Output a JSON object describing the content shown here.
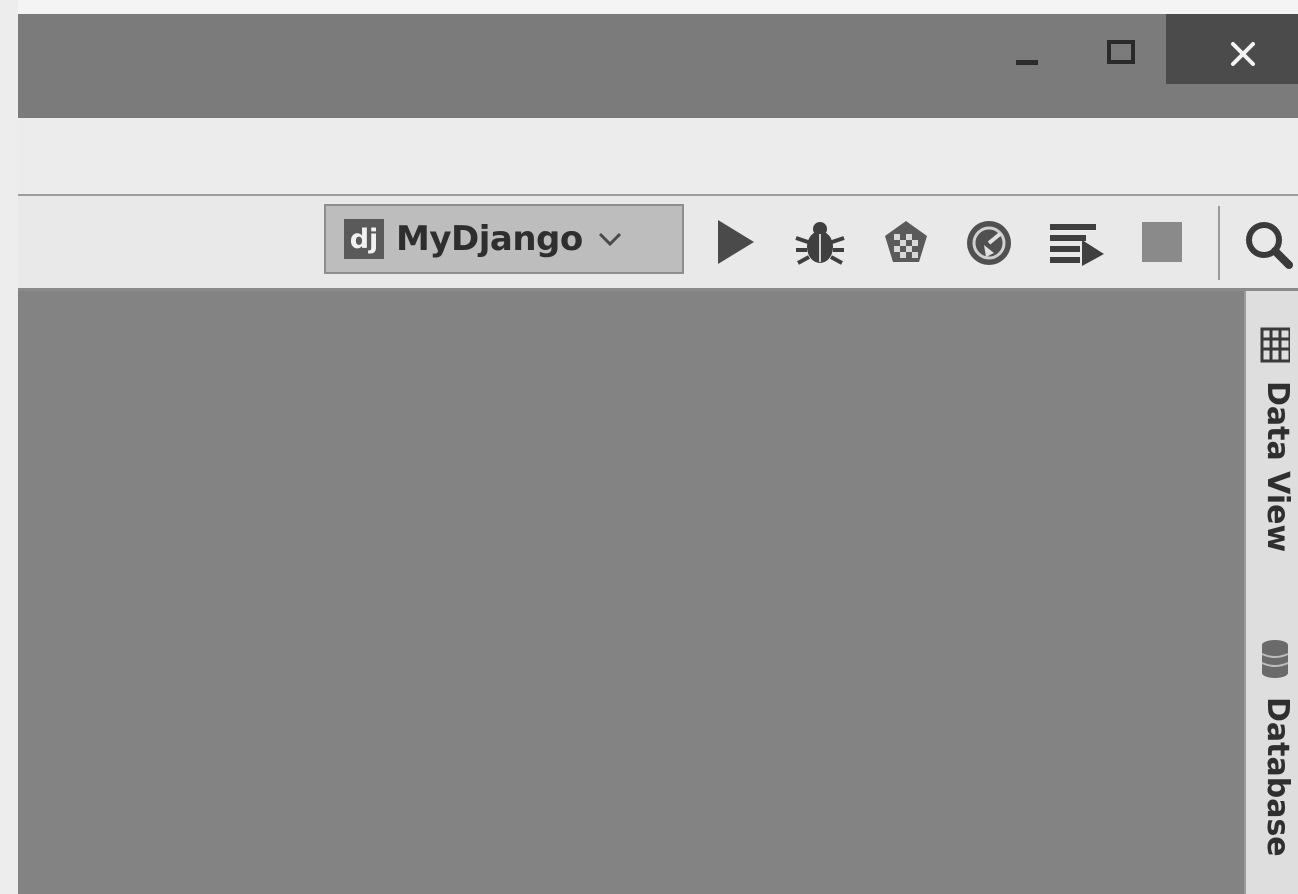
{
  "window": {
    "controls": {
      "minimize_icon": "minimize-icon",
      "maximize_icon": "maximize-icon",
      "close_icon": "close-icon"
    }
  },
  "toolbar": {
    "run_config": {
      "icon_text": "dj",
      "label": "MyDjango",
      "chevron_icon": "chevron-down-icon"
    },
    "actions": [
      "run-icon",
      "debug-icon",
      "coverage-icon",
      "profile-icon",
      "concurrency-icon",
      "stop-icon"
    ],
    "search_icon": "search-icon"
  },
  "right_sidebar": {
    "tabs": [
      {
        "label": "Data View",
        "icon": "table-icon"
      },
      {
        "label": "Database",
        "icon": "database-icon"
      }
    ]
  },
  "colors": {
    "titlebar": "#7b7b7b",
    "close_button": "#4b4b4b",
    "editor_background": "#838383",
    "toolbar_background": "#e9e9e9"
  }
}
